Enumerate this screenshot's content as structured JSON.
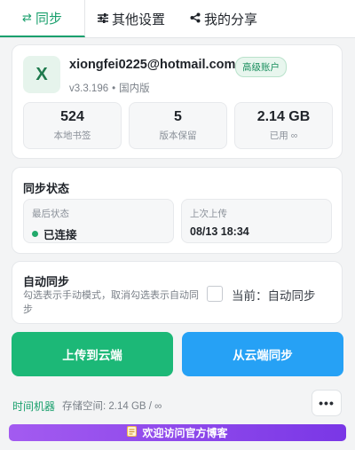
{
  "tabs": [
    {
      "label": "同步",
      "icon": "sync-icon",
      "glyph": "⇄"
    },
    {
      "label": "其他设置",
      "icon": "sliders-icon",
      "glyph": "☰"
    },
    {
      "label": "我的分享",
      "icon": "share-icon",
      "glyph": "⋖"
    }
  ],
  "account": {
    "avatar_letter": "X",
    "email": "xiongfei0225@hotmail.com",
    "badge": "高级账户",
    "version": "v3.3.196",
    "region": "国内版",
    "stats": [
      {
        "value": "524",
        "label": "本地书签"
      },
      {
        "value": "5",
        "label": "版本保留"
      },
      {
        "value": "2.14 GB",
        "label": "已用 ∞"
      }
    ]
  },
  "status": {
    "title": "同步状态",
    "last_status_label": "最后状态",
    "last_status_value": "已连接",
    "last_upload_label": "上次上传",
    "last_upload_value": "08/13 18:34"
  },
  "auto_sync": {
    "title": "自动同步",
    "description": "勾选表示手动模式，取消勾选表示自动同步",
    "checked": false,
    "current": "当前：自动同步"
  },
  "actions": {
    "upload": "上传到云端",
    "download": "从云端同步"
  },
  "footer": {
    "time_machine": "时间机器",
    "storage": "存储空间: 2.14 GB / ∞",
    "more": "•••"
  },
  "banner": {
    "icon": "note-icon",
    "text": "欢迎访问官方博客"
  },
  "colors": {
    "accent_green": "#1cb877",
    "accent_blue": "#26a1f5",
    "banner_purple": "#8b45ea"
  }
}
